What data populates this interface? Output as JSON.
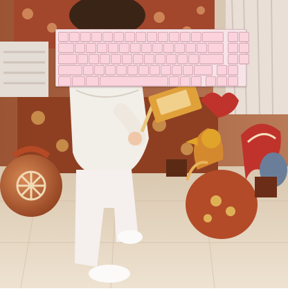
{
  "image": {
    "subject": "toddler-with-keyboard-overlay",
    "colors": {
      "wall": "#a9623b",
      "floor": "#e6d8c3",
      "keyboard_case": "#f7e4e8",
      "keycap": "#fbd3dc",
      "rooster_red": "#c0332c",
      "rooster_gold": "#e0a42a"
    }
  }
}
